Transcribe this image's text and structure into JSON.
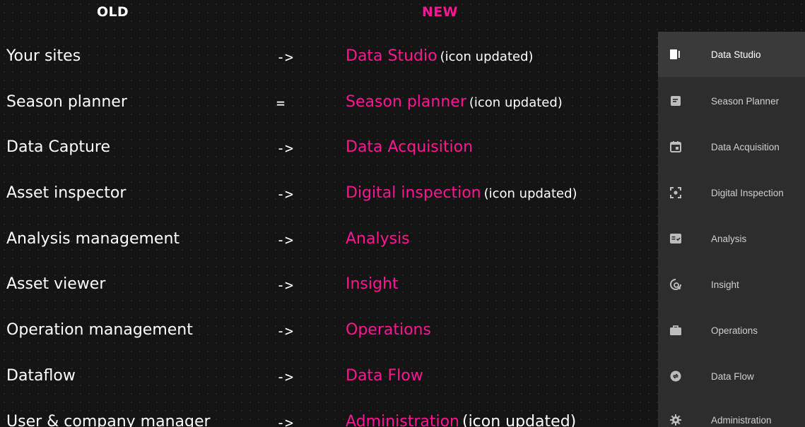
{
  "headers": {
    "old": "OLD",
    "new": "NEW"
  },
  "rows": [
    {
      "old": "Your sites",
      "symbol": "->",
      "new": "Data Studio",
      "note": "(icon updated)"
    },
    {
      "old": "Season planner",
      "symbol": "=",
      "new": "Season planner",
      "note": "(icon updated)"
    },
    {
      "old": "Data Capture",
      "symbol": "->",
      "new": "Data Acquisition",
      "note": ""
    },
    {
      "old": "Asset inspector",
      "symbol": "->",
      "new": "Digital inspection",
      "note": "(icon updated)"
    },
    {
      "old": "Analysis management",
      "symbol": "->",
      "new": "Analysis",
      "note": ""
    },
    {
      "old": "Asset viewer",
      "symbol": "->",
      "new": "Insight",
      "note": ""
    },
    {
      "old": "Operation management",
      "symbol": "->",
      "new": "Operations",
      "note": ""
    },
    {
      "old": "Dataflow",
      "symbol": "->",
      "new": "Data Flow",
      "note": ""
    },
    {
      "old": "User & company manager",
      "symbol": "->",
      "new": "Administration",
      "note": "(icon updated)"
    }
  ],
  "sidebar": {
    "items": [
      {
        "label": "Data Studio",
        "icon": "data-studio-icon",
        "active": true
      },
      {
        "label": "Season Planner",
        "icon": "season-planner-icon",
        "active": false
      },
      {
        "label": "Data Acquisition",
        "icon": "calendar-icon",
        "active": false
      },
      {
        "label": "Digital Inspection",
        "icon": "inspection-icon",
        "active": false
      },
      {
        "label": "Analysis",
        "icon": "analysis-icon",
        "active": false
      },
      {
        "label": "Insight",
        "icon": "insight-icon",
        "active": false
      },
      {
        "label": "Operations",
        "icon": "briefcase-icon",
        "active": false
      },
      {
        "label": "Data Flow",
        "icon": "data-flow-icon",
        "active": false
      },
      {
        "label": "Administration",
        "icon": "gear-icon",
        "active": false
      }
    ]
  },
  "colors": {
    "accent": "#ff1493",
    "background": "#141414",
    "sidebar_bg": "#2d2d2d",
    "sidebar_active": "#3a3a3a"
  }
}
